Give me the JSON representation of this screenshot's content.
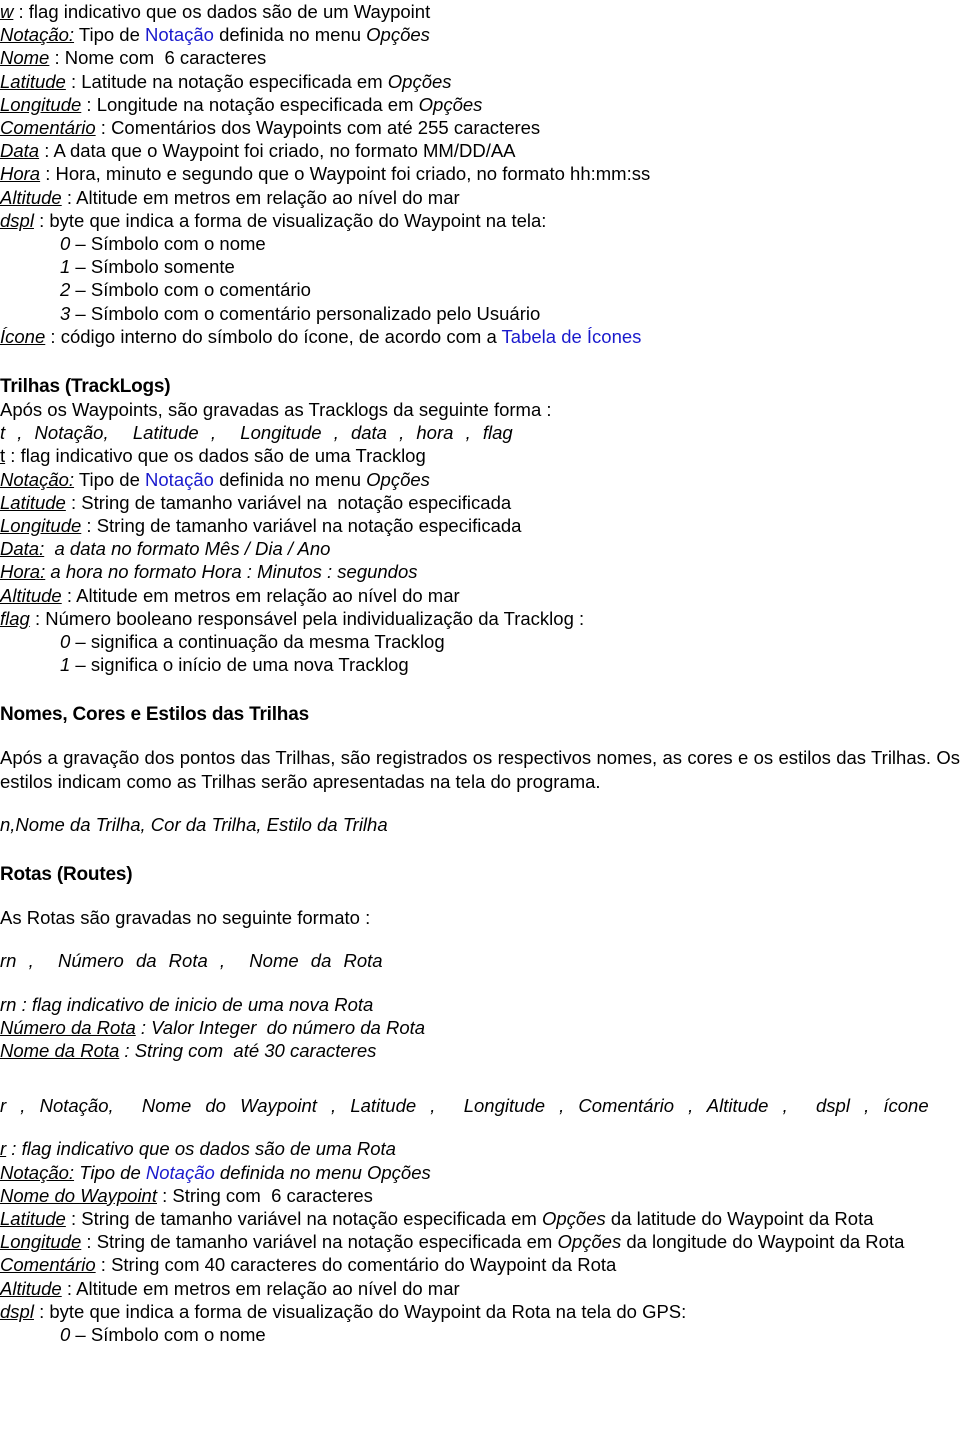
{
  "colors": {
    "text": "#000000",
    "link": "#1a1acd",
    "background": "#ffffff"
  },
  "waypoint_section": {
    "fields": [
      {
        "label": "w",
        "label_style": "underline-italic",
        "sep": " : ",
        "desc_pre": "flag indicativo que os dados são de um Waypoint",
        "desc_link": "",
        "desc_post": ""
      },
      {
        "label": "Notação:",
        "label_style": "underline-italic",
        "sep": " ",
        "desc_pre": "Tipo de ",
        "desc_link": "Notação",
        "desc_post": " definida no menu ",
        "desc_italic_tail": "Opções"
      },
      {
        "label": "Nome",
        "label_style": "underline-italic",
        "sep": " : ",
        "desc_pre": "Nome com  6 caracteres",
        "desc_link": "",
        "desc_post": ""
      },
      {
        "label": "Latitude",
        "label_style": "underline-italic",
        "sep": " : ",
        "desc_pre": "Latitude na notação especificada em ",
        "desc_link": "",
        "desc_post": "",
        "desc_italic_tail": "Opções"
      },
      {
        "label": "Longitude",
        "label_style": "underline-italic",
        "sep": " : ",
        "desc_pre": "Longitude na notação especificada em ",
        "desc_link": "",
        "desc_post": "",
        "desc_italic_tail": "Opções"
      },
      {
        "label": "Comentário",
        "label_style": "underline-italic",
        "sep": " : ",
        "desc_pre": "Comentários dos Waypoints com até 255 caracteres",
        "desc_link": "",
        "desc_post": ""
      },
      {
        "label": "Data",
        "label_style": "underline-italic",
        "sep": " : ",
        "desc_pre": "A data que o Waypoint foi criado, no formato MM/DD/AA",
        "desc_link": "",
        "desc_post": ""
      },
      {
        "label": "Hora",
        "label_style": "underline-italic",
        "sep": " : ",
        "desc_pre": "Hora, minuto e segundo que o Waypoint foi criado, no formato hh:mm:ss",
        "desc_link": "",
        "desc_post": ""
      },
      {
        "label": "Altitude",
        "label_style": "underline-italic",
        "sep": " : ",
        "desc_pre": "Altitude em metros em relação ao nível do mar",
        "desc_link": "",
        "desc_post": ""
      },
      {
        "label": "dspl",
        "label_style": "underline-italic",
        "sep": " : ",
        "desc_pre": "byte que indica a forma de visualização do Waypoint na tela:",
        "desc_link": "",
        "desc_post": ""
      }
    ],
    "dspl_values": [
      {
        "num": "0",
        "dash": " – ",
        "text": "Símbolo com o nome"
      },
      {
        "num": "1",
        "dash": " – ",
        "text": "Símbolo somente"
      },
      {
        "num": "2",
        "dash": " – ",
        "text": "Símbolo com o comentário"
      },
      {
        "num": "3",
        "dash": " – ",
        "text": "Símbolo com o comentário personalizado pelo Usuário"
      }
    ],
    "icone_label": "Ícone",
    "icone_sep": " : ",
    "icone_text": "código interno do símbolo do ícone, de acordo com a ",
    "icone_link": "Tabela de Ícones"
  },
  "tracklogs_section": {
    "heading": "Trilhas (TrackLogs)",
    "intro": "Após os Waypoints, são gravadas as Tracklogs da seguinte forma :",
    "format_line": "t , Notação,  Latitude ,  Longitude , data , hora , flag",
    "fields": [
      {
        "label": "t",
        "label_style": "underline",
        "sep": " : ",
        "desc": "flag indicativo que os dados são de uma Tracklog"
      },
      {
        "label": "Notação:",
        "label_style": "underline-italic",
        "sep": " ",
        "desc_pre": "Tipo de ",
        "desc_link": "Notação",
        "desc_post": " definida no menu ",
        "desc_italic_tail": "Opções"
      },
      {
        "label": "Latitude",
        "label_style": "underline-italic",
        "sep": " : ",
        "desc": "String de tamanho variável na  notação especificada"
      },
      {
        "label": "Longitude",
        "label_style": "underline-italic",
        "sep": " : ",
        "desc": "String de tamanho variável na notação especificada"
      },
      {
        "label": "Data:",
        "label_style": "underline-italic",
        "sep": " ",
        "desc": " a data no formato Mês / Dia / Ano",
        "desc_style": "italic"
      },
      {
        "label": "Hora:",
        "label_style": "underline-italic",
        "sep": " ",
        "desc": "a hora no formato Hora : Minutos : segundos",
        "desc_style": "italic"
      },
      {
        "label": "Altitude",
        "label_style": "underline-italic",
        "sep": " : ",
        "desc": "Altitude em metros em relação ao nível do mar"
      },
      {
        "label": "flag",
        "label_style": "underline-italic",
        "sep": " : ",
        "desc": "Número booleano responsável pela individualização da Tracklog :"
      }
    ],
    "flag_values": [
      {
        "num": "0",
        "dash": " – ",
        "text": "significa a continuação da mesma Tracklog"
      },
      {
        "num": "1",
        "dash": " – ",
        "text": "significa o início de uma nova Tracklog"
      }
    ]
  },
  "names_section": {
    "heading": "Nomes, Cores e Estilos das Trilhas",
    "paragraph": "Após a gravação dos pontos das Trilhas, são registrados os respectivos nomes, as cores e os estilos das Trilhas. Os estilos indicam como as Trilhas serão apresentadas na tela do programa.",
    "format_line": "n,Nome da Trilha, Cor da Trilha, Estilo da Trilha"
  },
  "routes_section": {
    "heading": "Rotas  (Routes)",
    "intro": "As Rotas são gravadas no seguinte formato :",
    "format_line": "rn ,  Número da Rota ,  Nome da Rota",
    "fields": [
      {
        "label": "rn",
        "label_style": "italic",
        "sep": " : ",
        "desc": "flag indicativo de inicio de uma nova Rota"
      },
      {
        "label": "Número da Rota",
        "label_style": "underline-italic",
        "sep": " : ",
        "desc": "Valor Integer  do número da Rota"
      },
      {
        "label": "Nome da Rota",
        "label_style": "underline-italic",
        "sep": " : ",
        "desc": "String com  até 30 caracteres"
      }
    ]
  },
  "route_waypoint_section": {
    "format_line": "r , Notação,  Nome do Waypoint , Latitude ,  Longitude , Comentário , Altitude ,  dspl , ícone",
    "fields": [
      {
        "label": "r",
        "label_style": "underline-italic",
        "sep": " : ",
        "desc": "flag indicativo que os dados são de uma Rota",
        "desc_style": "italic"
      },
      {
        "label": "Notação:",
        "label_style": "underline-italic",
        "sep": " ",
        "desc_pre": "Tipo de ",
        "desc_link": "Notação",
        "desc_post": " definida no menu Opções",
        "desc_style": "italic"
      },
      {
        "label": "Nome do Waypoint",
        "label_style": "underline-italic",
        "sep": " : ",
        "desc": "String com  6 caracteres"
      },
      {
        "label": "Latitude",
        "label_style": "underline-italic",
        "sep": " : ",
        "desc_pre": "String de tamanho variável na  notação especificada em ",
        "desc_italic_mid": "Opções",
        "desc_post": " da latitude do Waypoint da Rota"
      },
      {
        "label": "Longitude",
        "label_style": "underline-italic",
        "sep": " : ",
        "desc_pre": "String de tamanho variável na notação especificada em ",
        "desc_italic_mid": "Opções",
        "desc_post": " da longitude do Waypoint da Rota"
      },
      {
        "label": "Comentário",
        "label_style": "underline-italic",
        "sep": " : ",
        "desc": "String com 40 caracteres do comentário do Waypoint da Rota"
      },
      {
        "label": "Altitude",
        "label_style": "underline-italic",
        "sep": " : ",
        "desc": "Altitude em metros em relação ao nível do mar"
      },
      {
        "label": "dspl",
        "label_style": "underline-italic",
        "sep": " : ",
        "desc": "byte que indica a forma de visualização do Waypoint da Rota na tela do GPS:"
      }
    ],
    "dspl_values": [
      {
        "num": "0",
        "dash": " – ",
        "text": "Símbolo com o nome"
      }
    ]
  }
}
